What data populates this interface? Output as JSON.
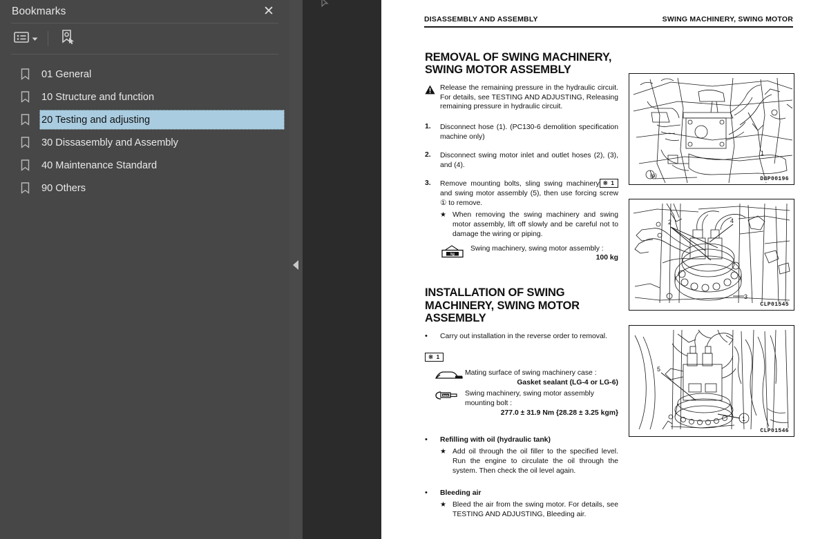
{
  "bookmarks_panel": {
    "title": "Bookmarks",
    "close_label": "✕",
    "toolbar": {
      "options_icon": "list-options-icon",
      "dropdown_icon": "chevron-down-icon",
      "new_bookmark_icon": "new-bookmark-icon"
    },
    "items": [
      {
        "label": "01 General",
        "selected": false
      },
      {
        "label": "10 Structure and function",
        "selected": false
      },
      {
        "label": "20 Testing and adjusting",
        "selected": true
      },
      {
        "label": "30 Dissasembly and Assembly",
        "selected": false
      },
      {
        "label": "40 Maintenance Standard",
        "selected": false
      },
      {
        "label": "90 Others",
        "selected": false
      }
    ],
    "collapse_icon": "collapse-left-arrow-icon",
    "colors": {
      "panel_bg": "#474747",
      "selection": "#a9cce0",
      "viewer_bg": "#2b2b2b"
    }
  },
  "document": {
    "running_head_left": "DISASSEMBLY AND ASSEMBLY",
    "running_head_right": "SWING MACHINERY, SWING MOTOR",
    "sections": [
      {
        "heading": "REMOVAL OF SWING MACHINERY, SWING MOTOR ASSEMBLY",
        "warning": "Release the remaining pressure in the hydraulic circuit.  For details, see TESTING AND ADJUSTING, Releasing remaining pressure in hydraulic circuit.",
        "steps": [
          {
            "no": "1.",
            "text": "Disconnect hose (1). (PC130-6 demolition specification machine only)"
          },
          {
            "no": "2.",
            "text": "Disconnect swing motor inlet and outlet hoses (2), (3), and (4)."
          },
          {
            "no": "3.",
            "text": "Remove mounting bolts, sling swing machinery and swing motor assembly (5), then use forcing screw ① to remove.",
            "ref": "※ 1",
            "note": "When removing the swing machinery and swing motor assembly, lift off slowly and be careful not to damage the wiring or piping.",
            "spec_label": "Swing machinery, swing motor assembly :",
            "spec_value": "100 kg",
            "spec_icon": "weight-kg-icon"
          }
        ]
      },
      {
        "heading": "INSTALLATION OF SWING MACHINERY, SWING MOTOR ASSEMBLY",
        "bullets": [
          {
            "text": "Carry out installation in the reverse order to removal."
          }
        ],
        "ref_marker": "※ 1",
        "specs": [
          {
            "icon": "sealant-icon",
            "label": "Mating surface of swing machinery case :",
            "value": "Gasket sealant (LG-4 or LG-6)"
          },
          {
            "icon": "torque-wrench-icon",
            "label": "Swing machinery, swing motor assembly mounting bolt :",
            "value": "277.0 ± 31.9 Nm {28.28 ± 3.25 kgm}"
          }
        ],
        "tail_bullets": [
          {
            "title": "Refilling with oil (hydraulic tank)",
            "note": "Add oil through the oil filler to the specified level.  Run the engine to circulate the oil through the system. Then check the oil level again."
          },
          {
            "title": "Bleeding air",
            "note": "Bleed the air from the swing motor. For details, see TESTING AND ADJUSTING, Bleeding air."
          }
        ]
      }
    ],
    "figures": [
      {
        "caption": "DBP00196",
        "alt": "swing-machinery-overview-drawing"
      },
      {
        "caption": "CLP01545",
        "alt": "swing-motor-hoses-drawing"
      },
      {
        "caption": "CLP01546",
        "alt": "swing-motor-assembly-drawing"
      }
    ]
  }
}
